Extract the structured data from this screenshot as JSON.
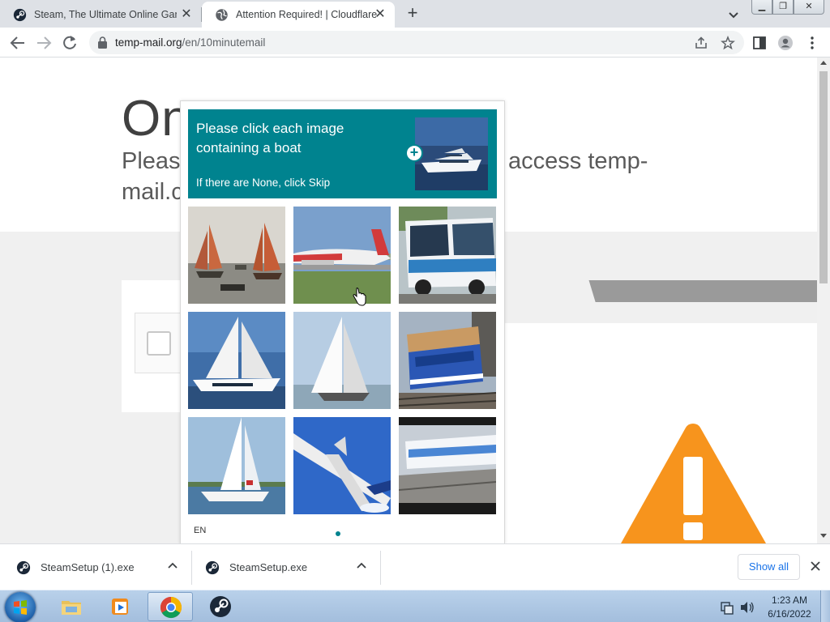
{
  "browser": {
    "tabs": [
      {
        "title": "Steam, The Ultimate Online Game Platform",
        "active": false,
        "icon": "steam-icon"
      },
      {
        "title": "Attention Required! | Cloudflare",
        "active": true,
        "icon": "globe-icon"
      }
    ],
    "new_tab_label": "+",
    "url_host": "temp-mail.org",
    "url_path": "/en/10minutemail"
  },
  "page": {
    "heading": "On",
    "subtitle_line1": "Please",
    "subtitle_line2": "mail.c",
    "subtitle_right": "access temp-"
  },
  "captcha": {
    "prompt_line": "Please click each image containing a boat",
    "hint": "If there are None, click Skip",
    "example_icon": "boat-image",
    "cells": [
      {
        "image": "sailboats"
      },
      {
        "image": "airplane"
      },
      {
        "image": "bus"
      },
      {
        "image": "sailboat"
      },
      {
        "image": "sailboat"
      },
      {
        "image": "train"
      },
      {
        "image": "sailboat"
      },
      {
        "image": "airplane"
      },
      {
        "image": "train"
      }
    ],
    "language": "EN",
    "accent": "#00838f"
  },
  "downloads": {
    "items": [
      {
        "name": "SteamSetup (1).exe"
      },
      {
        "name": "SteamSetup.exe"
      }
    ],
    "show_all": "Show all"
  },
  "taskbar": {
    "time": "1:23 AM",
    "date": "6/16/2022"
  },
  "colors": {
    "warning": "#f7941d",
    "link": "#1a73e8"
  }
}
